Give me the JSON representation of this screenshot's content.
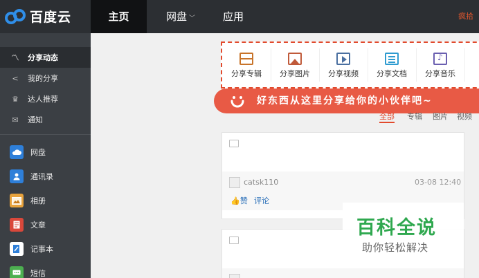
{
  "header": {
    "logo_text": "百度云",
    "nav": [
      {
        "label": "主页",
        "active": true
      },
      {
        "label": "网盘",
        "has_caret": true
      },
      {
        "label": "应用"
      }
    ],
    "user_partial": "疯拾"
  },
  "sidebar": {
    "items": [
      {
        "label": "分享动态",
        "icon": "activity-icon",
        "active": true
      },
      {
        "label": "我的分享",
        "icon": "share-icon"
      },
      {
        "label": "达人推荐",
        "icon": "crown-icon"
      },
      {
        "label": "通知",
        "icon": "mail-icon"
      }
    ],
    "apps": [
      {
        "label": "网盘",
        "icon": "cloud-icon",
        "color": "#2e7fd9"
      },
      {
        "label": "通讯录",
        "icon": "contacts-icon",
        "color": "#2e7fd9"
      },
      {
        "label": "相册",
        "icon": "photo-icon",
        "color": "#e8a33d"
      },
      {
        "label": "文章",
        "icon": "article-icon",
        "color": "#d9483b"
      },
      {
        "label": "记事本",
        "icon": "notepad-icon",
        "color": "#2e7fd9"
      },
      {
        "label": "短信",
        "icon": "sms-icon",
        "color": "#4caf50"
      }
    ]
  },
  "share_toolbar": {
    "buttons": [
      {
        "label": "分享专辑",
        "icon": "album-icon",
        "color": "#c8742a"
      },
      {
        "label": "分享图片",
        "icon": "image-icon",
        "color": "#c05a3a"
      },
      {
        "label": "分享视频",
        "icon": "video-icon",
        "color": "#4a6fa0"
      },
      {
        "label": "分享文档",
        "icon": "document-icon",
        "color": "#2e9bd0"
      },
      {
        "label": "分享音乐",
        "icon": "music-icon",
        "color": "#6a5fb0"
      }
    ]
  },
  "banner": {
    "text": "好东西从这里分享给你的小伙伴吧~"
  },
  "filters": [
    {
      "label": "全部",
      "active": true
    },
    {
      "label": "专辑"
    },
    {
      "label": "图片"
    },
    {
      "label": "视频"
    }
  ],
  "feed": [
    {
      "user": "catsk110",
      "time": "03-08 12:40",
      "like": "赞",
      "comment": "评论"
    }
  ],
  "watermark": {
    "title": "百科全说",
    "subtitle": "助你轻松解决"
  },
  "colors": {
    "topbar": "#2c2f33",
    "sidebar": "#3b3f44",
    "accent": "#e24a2d",
    "banner": "#e85a45",
    "link": "#2a6fb8",
    "watermark_green": "#2fa84f"
  }
}
